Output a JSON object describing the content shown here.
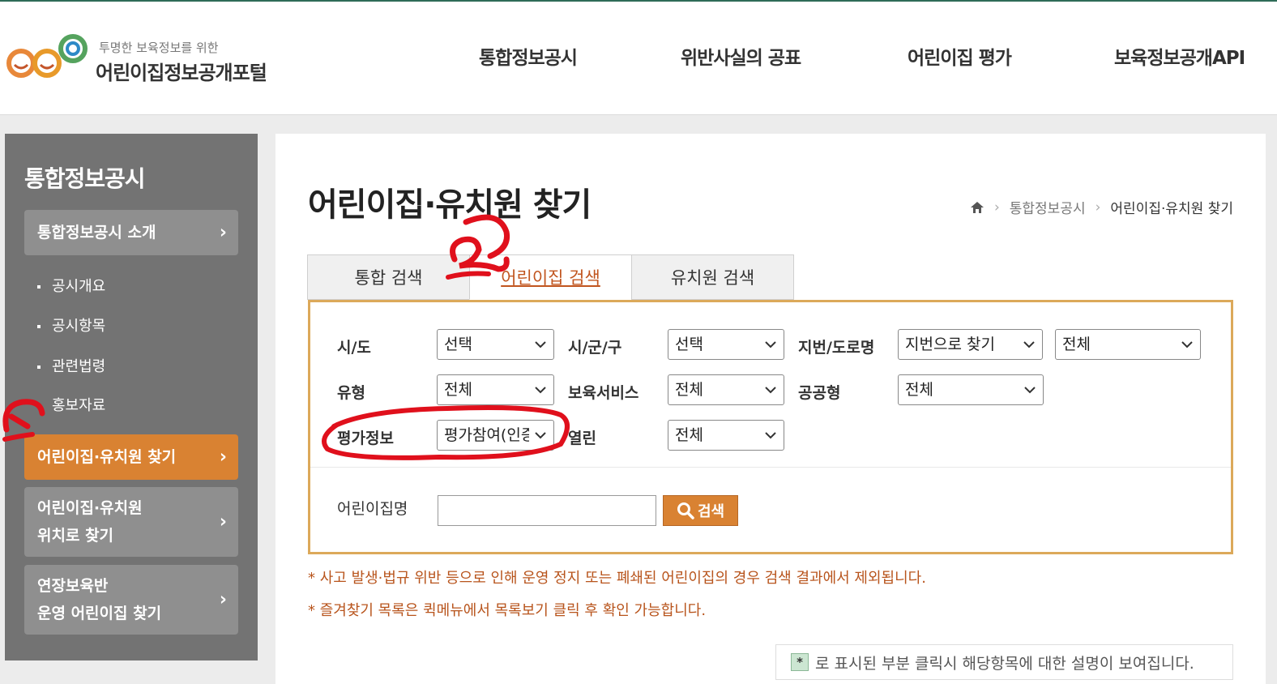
{
  "header": {
    "logo_sub": "투명한 보육정보를 위한",
    "logo_main": "어린이집정보공개포털",
    "nav": [
      "통합정보공시",
      "위반사실의 공표",
      "어린이집 평가",
      "보육정보공개API"
    ]
  },
  "sidebar": {
    "title": "통합정보공시",
    "intro_label": "통합정보공시 소개",
    "sub_items": [
      "공시개요",
      "공시항목",
      "관련법령",
      "홍보자료"
    ],
    "find_label": "어린이집·유치원 찾기",
    "location_label": "어린이집·유치원\n위치로 찾기",
    "extended_label": "연장보육반\n운영 어린이집 찾기"
  },
  "main": {
    "title": "어린이집·유치원 찾기",
    "breadcrumb": [
      "통합정보공시",
      "어린이집·유치원 찾기"
    ],
    "tabs": [
      "통합 검색",
      "어린이집 검색",
      "유치원 검색"
    ],
    "filters": {
      "sido_label": "시/도",
      "sido_value": "선택",
      "sigungu_label": "시/군/구",
      "sigungu_value": "선택",
      "address_label": "지번/도로명",
      "address_value": "지번으로 찾기",
      "address_value2": "전체",
      "type_label": "유형",
      "type_value": "전체",
      "service_label": "보육서비스",
      "service_value": "전체",
      "public_label": "공공형",
      "public_value": "전체",
      "eval_label": "평가정보",
      "eval_value": "평가참여(인증",
      "open_label": "열린",
      "open_value": "전체",
      "name_label": "어린이집명",
      "name_value": "",
      "search_button": "검색"
    },
    "notes": [
      "* 사고 발생·법규 위반 등으로 인해 운영 정지 또는 폐쇄된 어린이집의 경우 검색 결과에서 제외됩니다.",
      "* 즐겨찾기 목록은 퀵메뉴에서 목록보기 클릭 후 확인 가능합니다."
    ],
    "hint_star": "*",
    "hint_text": "로 표시된 부분 클릭시 해당항목에 대한 설명이 보여집니다."
  },
  "colors": {
    "accent": "#d98232",
    "box_border": "#dca95a",
    "sidebar_bg": "#737373",
    "annotation": "#e0101c"
  }
}
